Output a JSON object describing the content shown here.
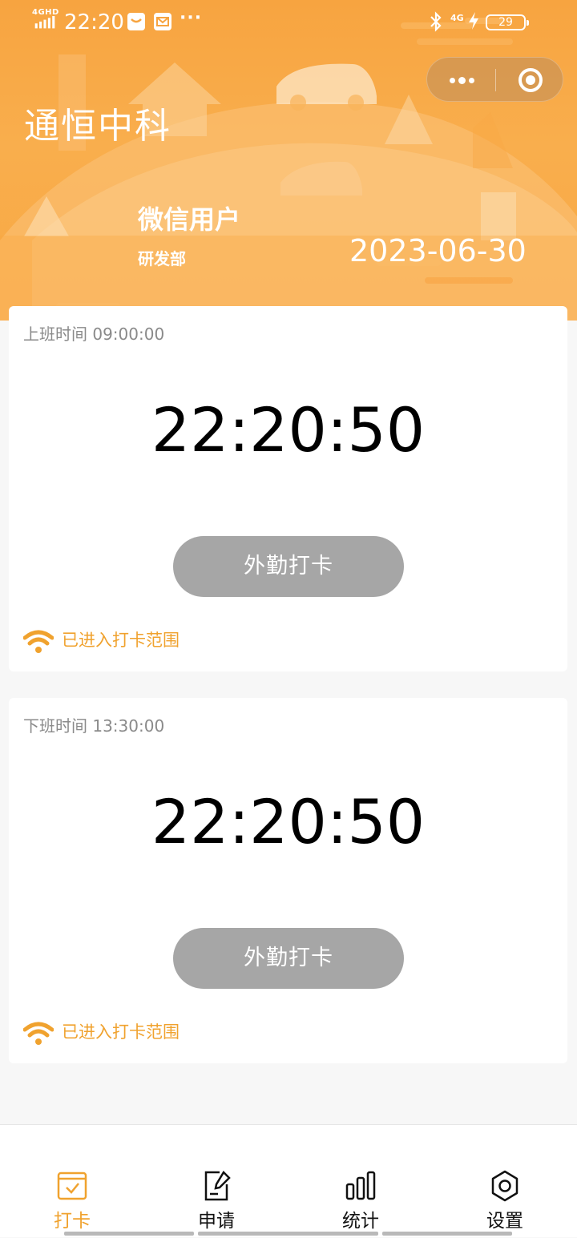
{
  "status_bar": {
    "network": "4GHD",
    "time": "22:20",
    "overflow": "···",
    "right_network": "4G",
    "battery": "29",
    "icons": [
      "signal-icon",
      "message-icon",
      "mail-icon",
      "bluetooth-icon",
      "charging-icon",
      "battery-icon"
    ]
  },
  "capsule": {
    "icons": [
      "more-icon",
      "close-miniprogram-icon"
    ]
  },
  "header": {
    "app_title": "通恒中科",
    "user_name": "微信用户",
    "department": "研发部",
    "date": "2023-06-30"
  },
  "cards": [
    {
      "shift_label": "上班时间 09:00:00",
      "clock": "22:20:50",
      "button_label": "外勤打卡",
      "range_status": "已进入打卡范围"
    },
    {
      "shift_label": "下班时间 13:30:00",
      "clock": "22:20:50",
      "button_label": "外勤打卡",
      "range_status": "已进入打卡范围"
    }
  ],
  "tabbar": {
    "tabs": [
      {
        "label": "打卡",
        "icon": "clock-in-icon",
        "active": true
      },
      {
        "label": "申请",
        "icon": "apply-icon",
        "active": false
      },
      {
        "label": "统计",
        "icon": "stats-icon",
        "active": false
      },
      {
        "label": "设置",
        "icon": "settings-icon",
        "active": false
      }
    ]
  },
  "colors": {
    "accent": "#f0a22e",
    "header_orange": "#f8a843",
    "button_disabled": "#a6a6a6",
    "text_muted": "#8a8a8a"
  }
}
